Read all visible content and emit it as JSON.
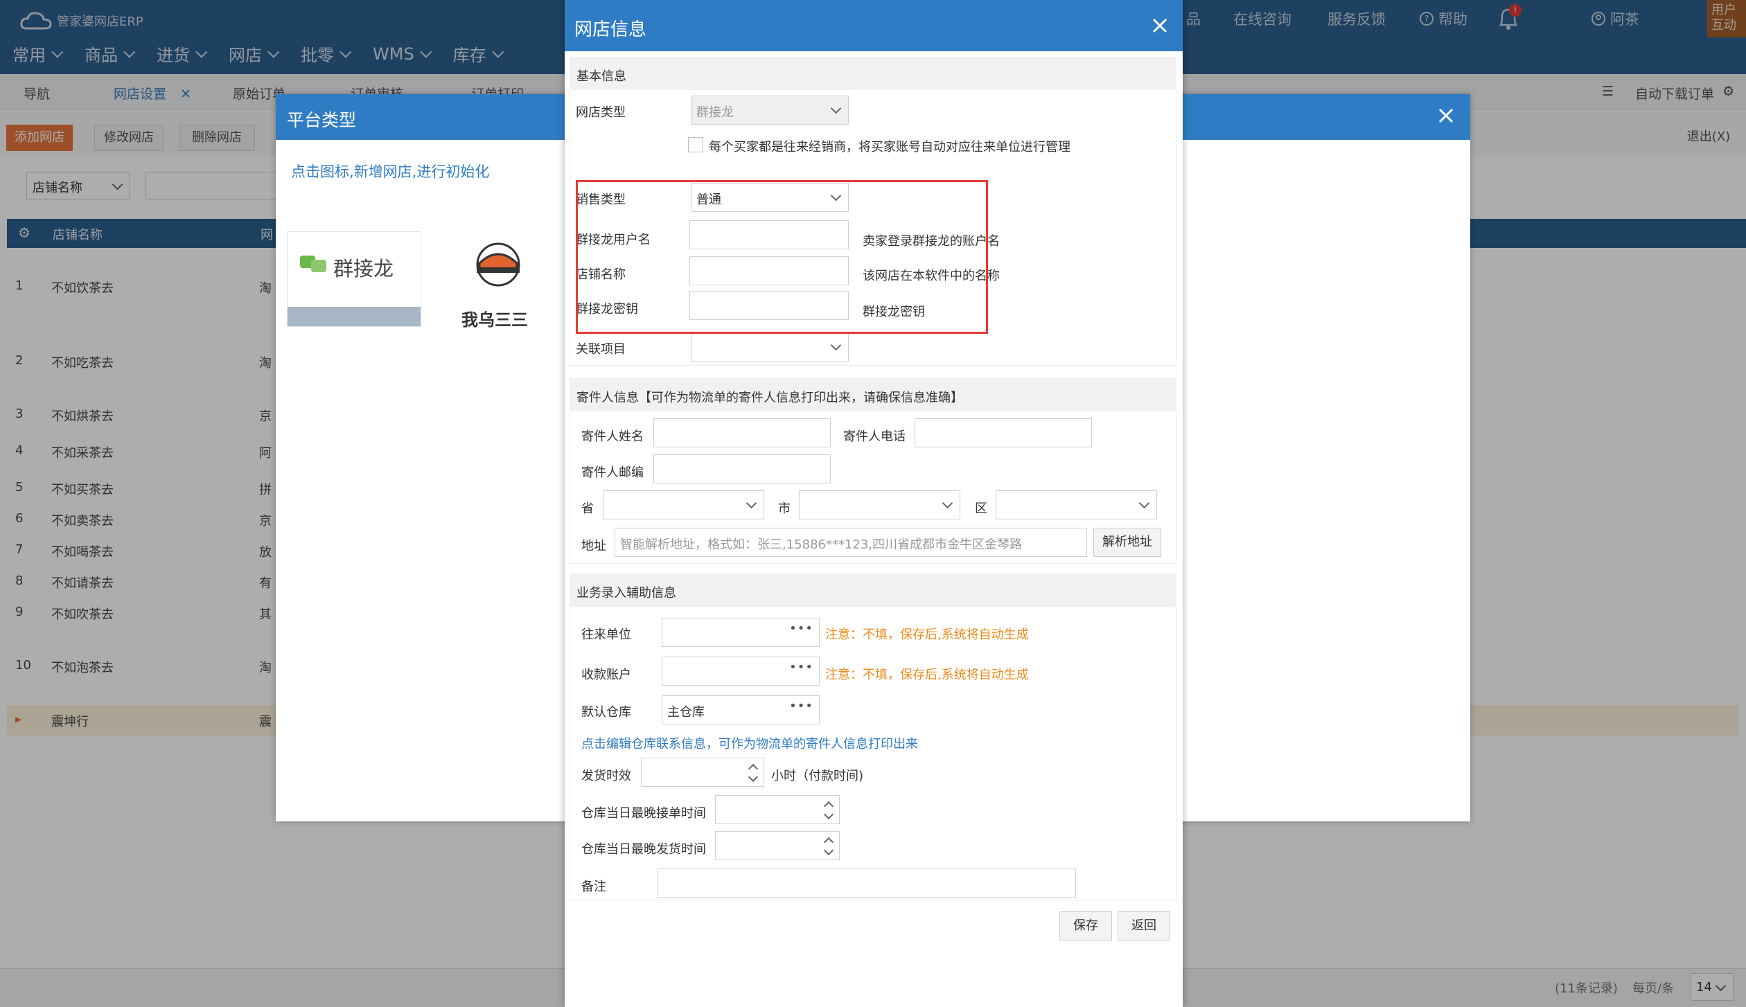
{
  "app": {
    "brand": "管家婆网店ERP",
    "menu": [
      {
        "label": "常用"
      },
      {
        "label": "商品"
      },
      {
        "label": "进货"
      },
      {
        "label": "网店"
      },
      {
        "label": "批零"
      },
      {
        "label": "WMS"
      },
      {
        "label": "库存"
      }
    ],
    "topright": {
      "item_cut": "品",
      "consult": "在线咨询",
      "feedback": "服务反馈",
      "help": "帮助",
      "bell_badge": "!",
      "user": "阿茶",
      "user_box": "用户互动"
    },
    "tabs": {
      "nav": "导航",
      "shop_settings": "网店设置",
      "raw_orders": "原始订单",
      "order_audit": "订单审核",
      "order_print": "订单打印",
      "auto_download": "自动下载订单"
    },
    "toolbar": {
      "add": "添加网店",
      "edit": "修改网店",
      "delete": "删除网店",
      "exit": "退出(X)"
    },
    "filter": {
      "field": "店铺名称"
    },
    "grid": {
      "head_name": "店铺名称",
      "head_platform": "网",
      "rows": [
        {
          "n": "1",
          "name": "不如饮茶去",
          "p": "淘"
        },
        {
          "n": "2",
          "name": "不如吃茶去",
          "p": "淘"
        },
        {
          "n": "3",
          "name": "不如烘茶去",
          "p": "京"
        },
        {
          "n": "4",
          "name": "不如采茶去",
          "p": "阿"
        },
        {
          "n": "5",
          "name": "不如买茶去",
          "p": "拼"
        },
        {
          "n": "6",
          "name": "不如卖茶去",
          "p": "京"
        },
        {
          "n": "7",
          "name": "不如喝茶去",
          "p": "放"
        },
        {
          "n": "8",
          "name": "不如请茶去",
          "p": "有"
        },
        {
          "n": "9",
          "name": "不如吹茶去",
          "p": "其"
        },
        {
          "n": "10",
          "name": "不如泡茶去",
          "p": "淘"
        },
        {
          "n": "▸",
          "name": "震坤行",
          "p": "震"
        }
      ]
    },
    "footer": {
      "records": "(11条记录)",
      "per_page_label": "每页/条",
      "per_page": "14"
    }
  },
  "platform_dialog": {
    "title": "平台类型",
    "hint": "点击图标,新增网店,进行初始化",
    "tiles": [
      {
        "label": "群接龙"
      },
      {
        "label": "我乌三三"
      }
    ]
  },
  "shop_dialog": {
    "title": "网店信息",
    "basic": {
      "header": "基本信息",
      "shop_type_label": "网店类型",
      "shop_type_value": "群接龙",
      "buyer_option": "每个买家都是往来经销商，将买家账号自动对应往来单位进行管理",
      "sales_type_label": "销售类型",
      "sales_type_value": "普通",
      "username_label": "群接龙用户名",
      "username_note": "卖家登录群接龙的账户名",
      "store_name_label": "店铺名称",
      "store_name_note": "该网店在本软件中的名称",
      "secret_label": "群接龙密钥",
      "secret_note": "群接龙密钥",
      "project_label": "关联项目"
    },
    "sender": {
      "header": "寄件人信息【可作为物流单的寄件人信息打印出来，请确保信息准确】",
      "name_label": "寄件人姓名",
      "phone_label": "寄件人电话",
      "zip_label": "寄件人邮编",
      "province_label": "省",
      "city_label": "市",
      "district_label": "区",
      "address_label": "地址",
      "address_placeholder": "智能解析地址，格式如：张三,15886***123,四川省成都市金牛区金琴路",
      "parse_button": "解析地址"
    },
    "business": {
      "header": "业务录入辅助信息",
      "partner_label": "往来单位",
      "partner_warn": "注意：不填，保存后,系统将自动生成",
      "account_label": "收款账户",
      "account_warn": "注意：不填，保存后,系统将自动生成",
      "warehouse_label": "默认仓库",
      "warehouse_value": "主仓库",
      "warehouse_link": "点击编辑仓库联系信息，可作为物流单的寄件人信息打印出来",
      "ship_time_label": "发货时效",
      "ship_time_unit": "小时（付款时间)",
      "latest_accept_label": "仓库当日最晚接单时间",
      "latest_ship_label": "仓库当日最晚发货时间",
      "remark_label": "备注"
    },
    "actions": {
      "save": "保存",
      "back": "返回"
    }
  }
}
